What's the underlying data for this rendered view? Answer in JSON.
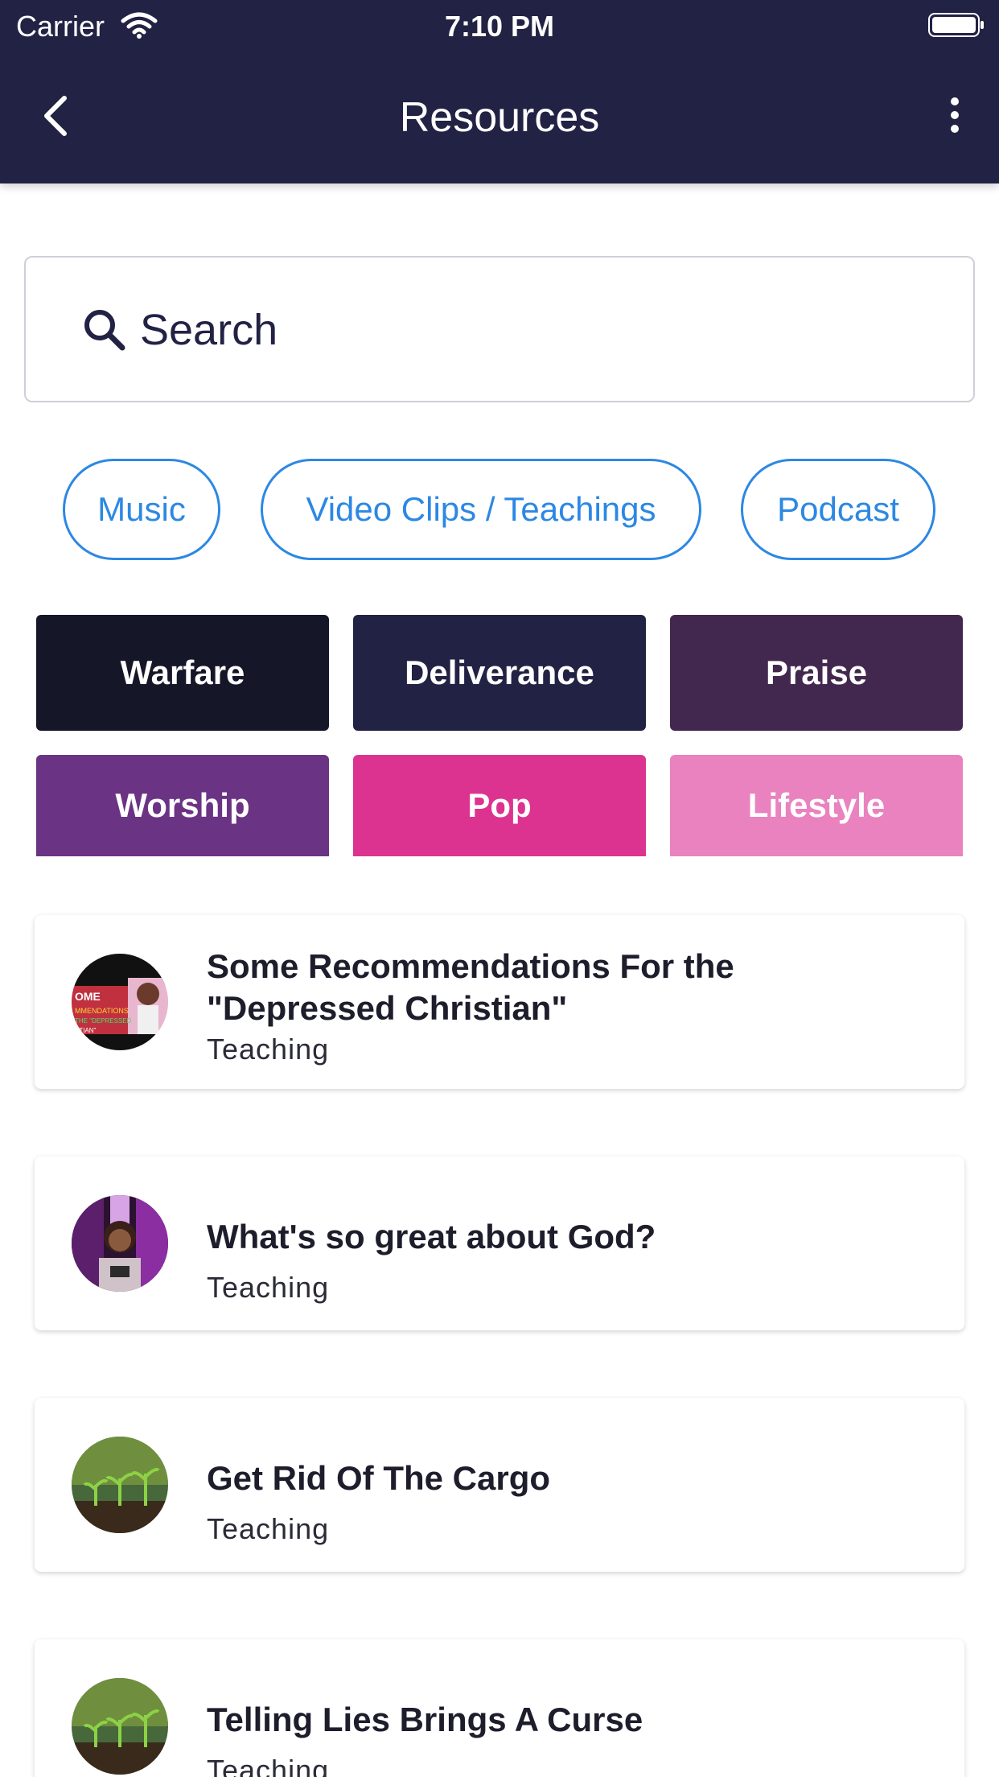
{
  "status_bar": {
    "carrier": "Carrier",
    "time": "7:10 PM"
  },
  "header": {
    "title": "Resources"
  },
  "search": {
    "placeholder": "Search"
  },
  "chips": [
    {
      "label": "Music"
    },
    {
      "label": "Video Clips / Teachings"
    },
    {
      "label": "Podcast"
    }
  ],
  "categories": [
    {
      "label": "Warfare",
      "color": "#161629"
    },
    {
      "label": "Deliverance",
      "color": "#222244"
    },
    {
      "label": "Praise",
      "color": "#42284f"
    },
    {
      "label": "Worship",
      "color": "#6b3384"
    },
    {
      "label": "Pop",
      "color": "#dc3391"
    },
    {
      "label": "Lifestyle",
      "color": "#e982bf"
    }
  ],
  "resources": [
    {
      "title": "Some Recommendations For the \"Depressed Christian\"",
      "type": "Teaching",
      "thumb_text": "ME MMENDATIONS THE \"DEPRESSED STIAN\""
    },
    {
      "title": "What's so great about God?",
      "type": "Teaching"
    },
    {
      "title": "Get Rid Of The Cargo",
      "type": "Teaching"
    },
    {
      "title": "Telling Lies Brings A Curse",
      "type": "Teaching"
    }
  ]
}
